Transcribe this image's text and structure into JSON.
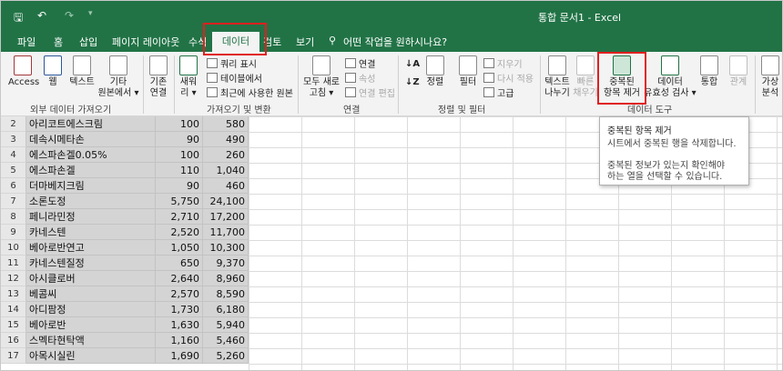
{
  "window": {
    "title": "통합 문서1  -  Excel"
  },
  "tabs": [
    "파일",
    "홈",
    "삽입",
    "페이지 레이아웃",
    "수식",
    "데이터",
    "검토",
    "보기"
  ],
  "tell_me": "어떤 작업을 원하시나요?",
  "ribbon": {
    "get_external": {
      "access": "Access",
      "web": "웹",
      "text": "텍스트",
      "other1": "기타",
      "other2": "원본에서 ▾",
      "group": "외부 데이터 가져오기"
    },
    "get_transform": {
      "existing1": "기존",
      "existing2": "연결",
      "new1": "새워",
      "new2": "리 ▾",
      "show_query": "쿼리 표시",
      "from_table": "테이블에서",
      "recent": "최근에 사용한 원본",
      "group": "가져오기 및 변환"
    },
    "connections": {
      "refresh1": "모두 새로",
      "refresh2": "고침 ▾",
      "conn": "연결",
      "props": "속성",
      "edit_links": "연결 편집",
      "group": "연결"
    },
    "sort_filter": {
      "sort": "정렬",
      "filter": "필터",
      "clear": "지우기",
      "reapply": "다시 적용",
      "advanced": "고급",
      "group": "정렬 및 필터"
    },
    "data_tools": {
      "text_cols1": "텍스트",
      "text_cols2": "나누기",
      "flash1": "빠른",
      "flash2": "채우기",
      "remove_dup1": "중복된",
      "remove_dup2": "항목 제거",
      "validation1": "데이터",
      "validation2": "유효성 검사 ▾",
      "consolidate": "통합",
      "relations": "관계",
      "whatif1": "가상",
      "whatif2": "분석",
      "group": "데이터 도구"
    }
  },
  "tooltip": {
    "title": "중복된 항목 제거",
    "desc": "시트에서 중복된 행을 삭제합니다.",
    "info1": "중복된 정보가 있는지 확인해야",
    "info2": "하는 열을 선택할 수 있습니다."
  },
  "rows": [
    {
      "n": "2",
      "a": "아리코트에스크림",
      "b": "100",
      "c": "580"
    },
    {
      "n": "3",
      "a": "데속시메타손",
      "b": "90",
      "c": "490"
    },
    {
      "n": "4",
      "a": "에스파손겔0.05%",
      "b": "100",
      "c": "260"
    },
    {
      "n": "5",
      "a": "에스파손겔",
      "b": "110",
      "c": "1,040"
    },
    {
      "n": "6",
      "a": "더마베지크림",
      "b": "90",
      "c": "460"
    },
    {
      "n": "7",
      "a": "소론도정",
      "b": "5,750",
      "c": "24,100"
    },
    {
      "n": "8",
      "a": "페니라민정",
      "b": "2,710",
      "c": "17,200"
    },
    {
      "n": "9",
      "a": "카네스텐",
      "b": "2,520",
      "c": "11,700"
    },
    {
      "n": "10",
      "a": "베아로반연고",
      "b": "1,050",
      "c": "10,300"
    },
    {
      "n": "11",
      "a": "카네스텐질정",
      "b": "650",
      "c": "9,370"
    },
    {
      "n": "12",
      "a": "아시클로버",
      "b": "2,640",
      "c": "8,960"
    },
    {
      "n": "13",
      "a": "베콤씨",
      "b": "2,570",
      "c": "8,590"
    },
    {
      "n": "14",
      "a": "아디팜정",
      "b": "1,730",
      "c": "6,180"
    },
    {
      "n": "15",
      "a": "베아로반",
      "b": "1,630",
      "c": "5,940"
    },
    {
      "n": "16",
      "a": "스멕타현탁액",
      "b": "1,160",
      "c": "5,460"
    },
    {
      "n": "17",
      "a": "아목시실린",
      "b": "1,690",
      "c": "5,260"
    }
  ]
}
